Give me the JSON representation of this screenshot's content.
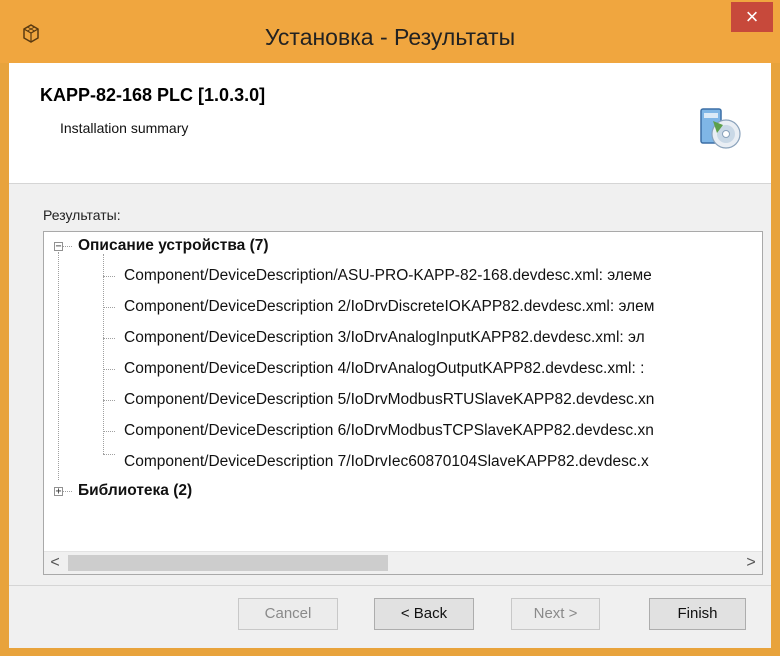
{
  "window": {
    "title": "Установка - Результаты",
    "close_label": "×"
  },
  "header": {
    "product": "KAPP-82-168 PLC [1.0.3.0]",
    "subtitle": "Installation summary"
  },
  "results_label": "Результаты:",
  "tree": {
    "groups": [
      {
        "label": "Описание устройства (7)",
        "expanded": true,
        "expander_symbol": "−",
        "items": [
          "Component/DeviceDescription/ASU-PRO-KAPP-82-168.devdesc.xml: элеме",
          "Component/DeviceDescription 2/IoDrvDiscreteIOKAPP82.devdesc.xml: элем",
          "Component/DeviceDescription 3/IoDrvAnalogInputKAPP82.devdesc.xml: эл",
          "Component/DeviceDescription 4/IoDrvAnalogOutputKAPP82.devdesc.xml: :",
          "Component/DeviceDescription 5/IoDrvModbusRTUSlaveKAPP82.devdesc.xn",
          "Component/DeviceDescription 6/IoDrvModbusTCPSlaveKAPP82.devdesc.xn",
          "Component/DeviceDescription 7/IoDrvIec60870104SlaveKAPP82.devdesc.x"
        ]
      },
      {
        "label": "Библиотека (2)",
        "expanded": false,
        "expander_symbol": "+",
        "items": []
      }
    ],
    "scroll_left": "<",
    "scroll_right": ">"
  },
  "buttons": {
    "cancel": "Cancel",
    "back": "< Back",
    "next": "Next >",
    "finish": "Finish"
  },
  "colors": {
    "titlebar": "#f0a63f",
    "close_button": "#c7493b"
  }
}
